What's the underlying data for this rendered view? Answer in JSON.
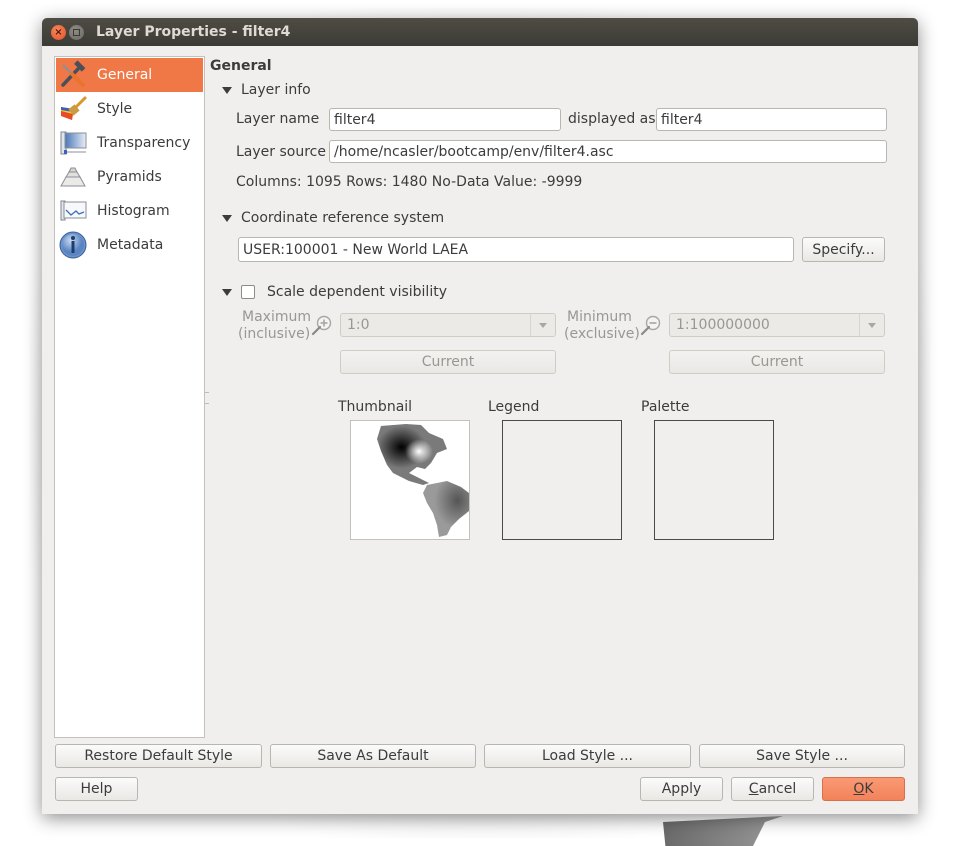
{
  "window": {
    "title": "Layer Properties - filter4",
    "close_glyph": "×"
  },
  "sidebar": {
    "items": [
      {
        "label": "General",
        "icon": "hammer-screwdriver-icon",
        "active": true
      },
      {
        "label": "Style",
        "icon": "paintbrush-icon",
        "active": false
      },
      {
        "label": "Transparency",
        "icon": "transparency-map-icon",
        "active": false
      },
      {
        "label": "Pyramids",
        "icon": "pyramid-icon",
        "active": false
      },
      {
        "label": "Histogram",
        "icon": "histogram-icon",
        "active": false
      },
      {
        "label": "Metadata",
        "icon": "info-icon",
        "active": false
      }
    ]
  },
  "general": {
    "title": "General",
    "layer_info": {
      "header": "Layer info",
      "layer_name_label": "Layer name",
      "layer_name_value": "filter4",
      "displayed_as_label": "displayed as",
      "displayed_as_value": "filter4",
      "layer_source_label": "Layer source",
      "layer_source_value": "/home/ncasler/bootcamp/env/filter4.asc",
      "stats": "Columns: 1095  Rows: 1480  No-Data Value: -9999"
    },
    "crs": {
      "header": "Coordinate reference system",
      "value": "USER:100001 - New World LAEA",
      "specify_label": "Specify..."
    },
    "scale": {
      "header": "Scale dependent visibility",
      "checked": false,
      "max_label_1": "Maximum",
      "max_label_2": "(inclusive)",
      "max_value": "1:0",
      "min_label_1": "Minimum",
      "min_label_2": "(exclusive)",
      "min_value": "1:100000000",
      "current_label": "Current"
    },
    "previews": {
      "thumbnail_label": "Thumbnail",
      "legend_label": "Legend",
      "palette_label": "Palette"
    }
  },
  "buttons": {
    "restore_default_style": "Restore Default Style",
    "save_as_default": "Save As Default",
    "load_style": "Load Style ...",
    "save_style": "Save Style ...",
    "help": "Help",
    "apply": "Apply",
    "cancel_mnemonic": "C",
    "cancel_rest": "ancel",
    "ok_mnemonic": "O",
    "ok_rest": "K"
  },
  "colors": {
    "accent": "#f07746",
    "titlebar": "#3d3b36",
    "close_button": "#e3502a"
  }
}
